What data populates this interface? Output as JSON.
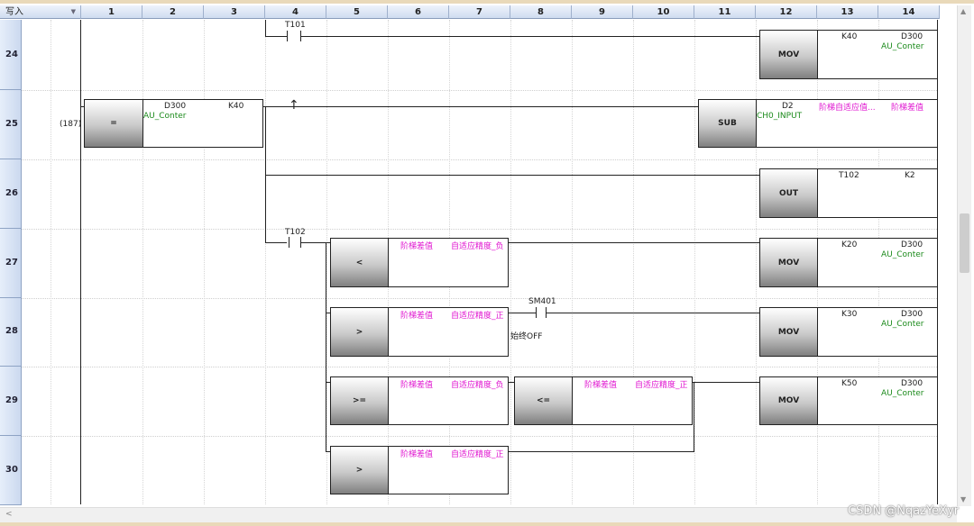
{
  "toolbar": {
    "mode": "写入"
  },
  "columns": [
    "1",
    "2",
    "3",
    "4",
    "5",
    "6",
    "7",
    "8",
    "9",
    "10",
    "11",
    "12",
    "13",
    "14"
  ],
  "rows": [
    "24",
    "25",
    "26",
    "27",
    "28",
    "29",
    "30"
  ],
  "step_number": "(187)",
  "contacts": {
    "t101": "T101",
    "t102": "T102",
    "sm401": "SM401",
    "sm401_comment": "始终OFF"
  },
  "rung24": {
    "op": "MOV",
    "a1": "K40",
    "a2": "D300",
    "a2c": "AU_Conter"
  },
  "rung25": {
    "cmp": {
      "op": "=",
      "a1": "D300",
      "a1c": "AU_Conter",
      "a2": "K40"
    },
    "sub": {
      "op": "SUB",
      "a1": "D2",
      "a1c": "CH0_INPUT",
      "a2": "阶梯自适应值...",
      "a3": "阶梯差值"
    }
  },
  "rung26": {
    "op": "OUT",
    "a1": "T102",
    "a2": "K2"
  },
  "rung27": {
    "cmp": {
      "op": "<",
      "a1": "阶梯差值",
      "a2": "自适应精度_负"
    },
    "mov": {
      "op": "MOV",
      "a1": "K20",
      "a2": "D300",
      "a2c": "AU_Conter"
    }
  },
  "rung28": {
    "cmp": {
      "op": ">",
      "a1": "阶梯差值",
      "a2": "自适应精度_正"
    },
    "mov": {
      "op": "MOV",
      "a1": "K30",
      "a2": "D300",
      "a2c": "AU_Conter"
    }
  },
  "rung29": {
    "cmp1": {
      "op": ">=",
      "a1": "阶梯差值",
      "a2": "自适应精度_负"
    },
    "cmp2": {
      "op": "<=",
      "a1": "阶梯差值",
      "a2": "自适应精度_正"
    },
    "mov": {
      "op": "MOV",
      "a1": "K50",
      "a2": "D300",
      "a2c": "AU_Conter"
    }
  },
  "rung30": {
    "cmp": {
      "op": ">",
      "a1": "阶梯差值",
      "a2": "自适应精度_正"
    }
  },
  "watermark": "CSDN @NqazYeXyr",
  "colors": {
    "header": "#cfdcf0",
    "operand_device": "#e016d0",
    "comment": "#1b8a1b"
  }
}
